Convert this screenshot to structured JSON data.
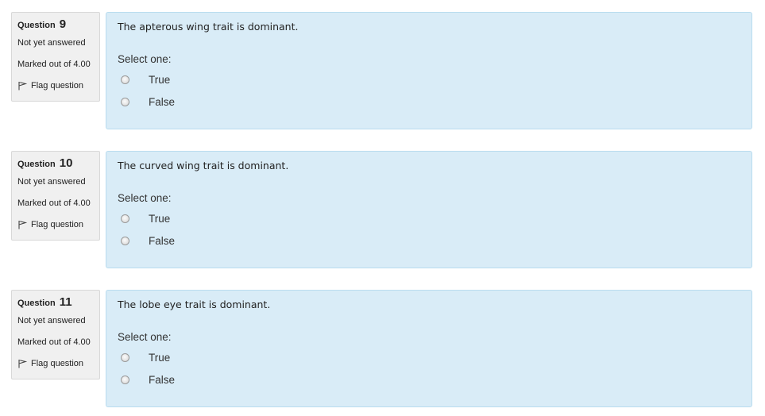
{
  "questions": [
    {
      "label": "Question",
      "number": "9",
      "state": "Not yet answered",
      "grade": "Marked out of 4.00",
      "flag_label": "Flag question",
      "text": "The apterous wing trait is dominant.",
      "prompt": "Select one:",
      "options": [
        "True",
        "False"
      ]
    },
    {
      "label": "Question",
      "number": "10",
      "state": "Not yet answered",
      "grade": "Marked out of 4.00",
      "flag_label": "Flag question",
      "text": "The curved wing trait is dominant.",
      "prompt": "Select one:",
      "options": [
        "True",
        "False"
      ]
    },
    {
      "label": "Question",
      "number": "11",
      "state": "Not yet answered",
      "grade": "Marked out of 4.00",
      "flag_label": "Flag question",
      "text": "The lobe eye trait is dominant.",
      "prompt": "Select one:",
      "options": [
        "True",
        "False"
      ]
    }
  ],
  "icons": {
    "flag": "flag-icon",
    "radio": "radio-unchecked-icon"
  },
  "colors": {
    "content_bg": "#d9ecf7",
    "content_border": "#b9dcef",
    "info_bg": "#f0f0f0"
  }
}
